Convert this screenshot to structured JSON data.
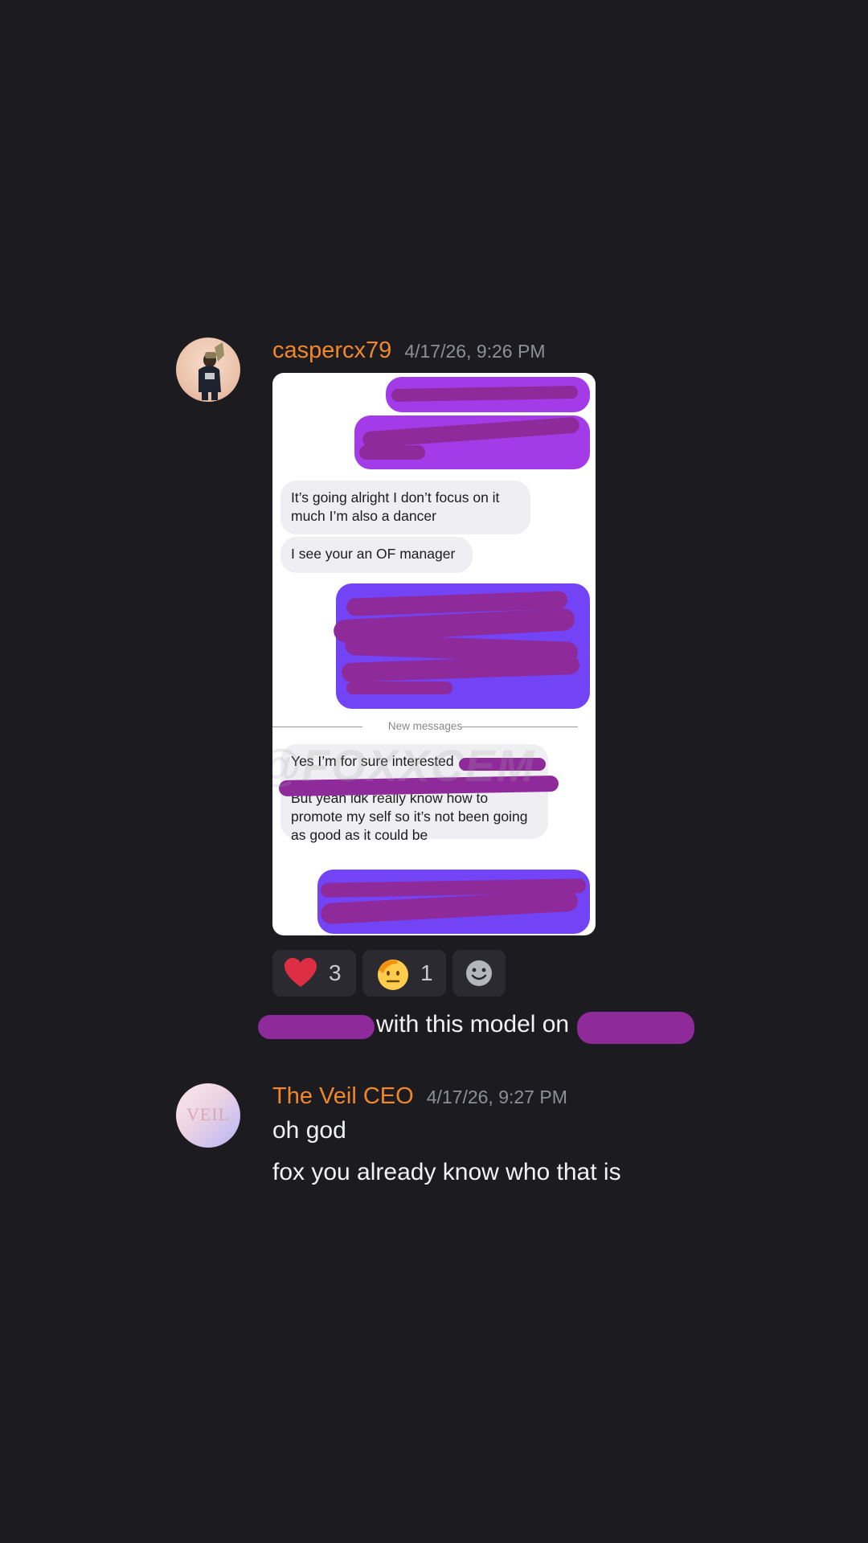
{
  "messages": [
    {
      "username": "caspercx79",
      "timestamp": "4/17/26, 9:26 PM",
      "avatar_icon": "user-photo-avatar",
      "screenshot": {
        "incoming_1": "It’s going alright I don’t focus on it much I’m also a dancer",
        "incoming_2": "I see your an OF manager",
        "divider_label": "New messages",
        "incoming_3_visible": "Yes I’m for sure interested",
        "incoming_4": "But yeah idk really know how to promote my self so it’s not been going as good as it could be",
        "watermark": "@FOXXCEM"
      },
      "reactions": [
        {
          "icon": "red-heart-emoji",
          "count": "3"
        },
        {
          "icon": "saluting-face-emoji",
          "count": "1"
        },
        {
          "icon": "add-reaction-icon",
          "count": ""
        }
      ],
      "follow_text": "with this model on"
    },
    {
      "username": "The Veil CEO",
      "timestamp": "4/17/26, 9:27 PM",
      "avatar_text": "VEIL",
      "lines": [
        "oh god",
        "fox you already know who that is"
      ]
    }
  ],
  "colors": {
    "background": "#1c1b20",
    "username": "#f0872a",
    "timestamp": "#8e9097",
    "redaction": "#8e2a9a",
    "outgoing_purple": "#a33be8",
    "outgoing_violet": "#7343f6"
  }
}
